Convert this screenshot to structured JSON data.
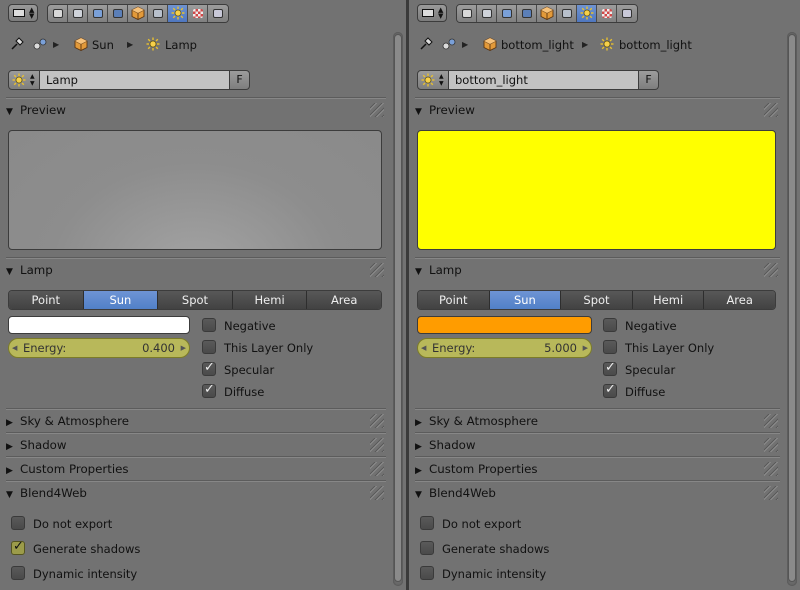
{
  "panels": [
    {
      "breadcrumb": {
        "object": "Sun",
        "data": "Lamp"
      },
      "datablock": {
        "name": "Lamp",
        "fake_user": "F"
      },
      "sections": {
        "preview": "Preview",
        "lamp": "Lamp",
        "sky": "Sky & Atmosphere",
        "shadow": "Shadow",
        "custom": "Custom Properties",
        "b4w": "Blend4Web"
      },
      "preview_color": "#8d8d8d",
      "lamp_types": [
        "Point",
        "Sun",
        "Spot",
        "Hemi",
        "Area"
      ],
      "active_lamp_type": "Sun",
      "lamp_color": "#ffffff",
      "energy": {
        "label": "Energy:",
        "value": "0.400"
      },
      "options": [
        {
          "label": "Negative",
          "checked": false
        },
        {
          "label": "This Layer Only",
          "checked": false
        },
        {
          "label": "Specular",
          "checked": true
        },
        {
          "label": "Diffuse",
          "checked": true
        }
      ],
      "b4w_options": [
        {
          "label": "Do not export",
          "checked": false
        },
        {
          "label": "Generate shadows",
          "checked": true
        },
        {
          "label": "Dynamic intensity",
          "checked": false
        }
      ]
    },
    {
      "breadcrumb": {
        "object": "bottom_light",
        "data": "bottom_light"
      },
      "datablock": {
        "name": "bottom_light",
        "fake_user": "F"
      },
      "sections": {
        "preview": "Preview",
        "lamp": "Lamp",
        "sky": "Sky & Atmosphere",
        "shadow": "Shadow",
        "custom": "Custom Properties",
        "b4w": "Blend4Web"
      },
      "preview_color": "#ffff00",
      "lamp_types": [
        "Point",
        "Sun",
        "Spot",
        "Hemi",
        "Area"
      ],
      "active_lamp_type": "Sun",
      "lamp_color": "#ff9c00",
      "energy": {
        "label": "Energy:",
        "value": "5.000"
      },
      "options": [
        {
          "label": "Negative",
          "checked": false
        },
        {
          "label": "This Layer Only",
          "checked": false
        },
        {
          "label": "Specular",
          "checked": true
        },
        {
          "label": "Diffuse",
          "checked": true
        }
      ],
      "b4w_options": [
        {
          "label": "Do not export",
          "checked": false
        },
        {
          "label": "Generate shadows",
          "checked": false
        },
        {
          "label": "Dynamic intensity",
          "checked": false
        }
      ]
    }
  ],
  "context_tabs": [
    "render-icon",
    "render-layers-icon",
    "scene-icon",
    "world-icon",
    "object-icon",
    "constraints-icon",
    "lamp-data-icon",
    "texture-icon",
    "physics-icon"
  ],
  "active_context_tab": "lamp-data-icon"
}
